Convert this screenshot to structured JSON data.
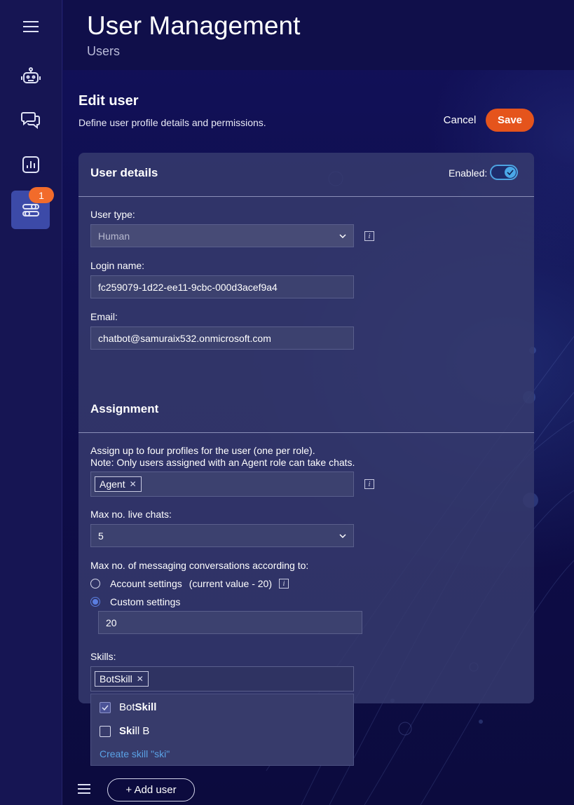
{
  "header": {
    "title": "User Management",
    "subtitle": "Users"
  },
  "sidebar": {
    "badge_count": "1",
    "items": [
      {
        "icon": "menu-icon"
      },
      {
        "icon": "robot-icon"
      },
      {
        "icon": "chat-icon"
      },
      {
        "icon": "chart-icon"
      },
      {
        "icon": "settings-sliders-icon",
        "active": true
      }
    ]
  },
  "page": {
    "title": "Edit user",
    "description": "Define user profile details and permissions.",
    "cancel_label": "Cancel",
    "save_label": "Save"
  },
  "user_details": {
    "title": "User details",
    "enabled_label": "Enabled:",
    "enabled": true,
    "user_type_label": "User type:",
    "user_type_value": "Human",
    "login_name_label": "Login name:",
    "login_name_value": "fc259079-1d22-ee11-9cbc-000d3acef9a4",
    "email_label": "Email:",
    "email_value": "chatbot@samuraix532.onmicrosoft.com"
  },
  "assignment": {
    "title": "Assignment",
    "profiles_note_1": "Assign up to four profiles for the user (one per role).",
    "profiles_note_2": "Note: Only users assigned with an Agent role can take chats.",
    "profile_tag": "Agent",
    "max_live_chats_label": "Max no. live chats:",
    "max_live_chats_value": "5",
    "max_messaging_label": "Max no. of messaging conversations according to:",
    "account_settings_label": "Account settings",
    "account_settings_current": "(current value - 20)",
    "custom_settings_label": "Custom settings",
    "custom_settings_value": "20",
    "skills_label": "Skills:",
    "skill_tag": "BotSkill"
  },
  "skills_dropdown": {
    "items": [
      {
        "prefix": "Bot",
        "match": "Skill",
        "suffix": "",
        "checked": true
      },
      {
        "prefix": "",
        "match": "Ski",
        "suffix": "ll B",
        "checked": false
      }
    ],
    "create_label": "Create skill \"ski\""
  },
  "footer": {
    "add_user_label": "+ Add user"
  },
  "colors": {
    "accent": "#e5541c",
    "badge": "#f26b2b",
    "toggle": "#4aa8e8",
    "link": "#5aa2e6"
  }
}
